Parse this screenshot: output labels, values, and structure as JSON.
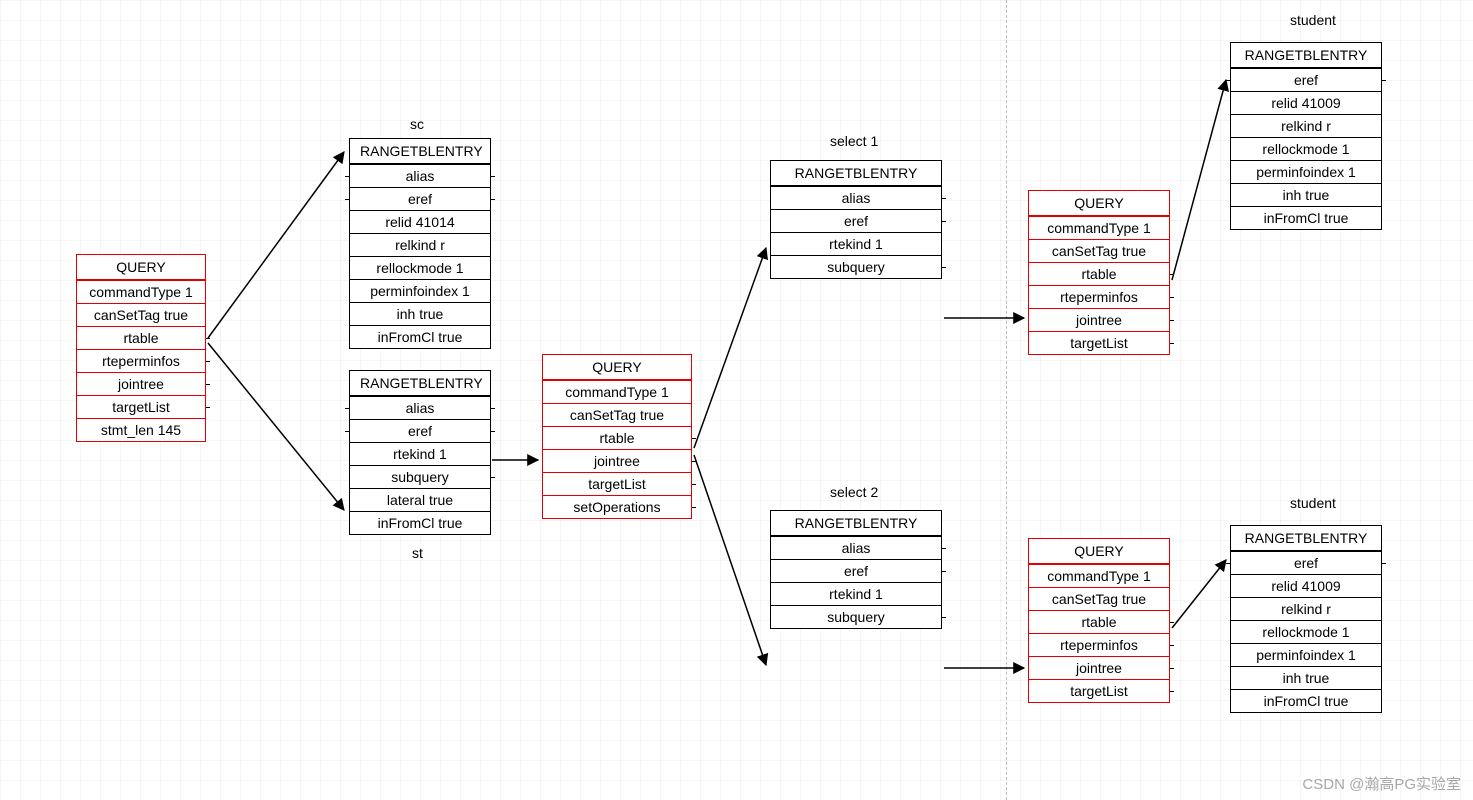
{
  "labels": {
    "sc": "sc",
    "st": "st",
    "select1": "select 1",
    "select2": "select 2",
    "student_top": "student",
    "student_bottom": "student"
  },
  "q1": {
    "title": "QUERY",
    "r0": "commandType 1",
    "r1": "canSetTag true",
    "r2": "rtable",
    "r3": "rteperminfos",
    "r4": "jointree",
    "r5": "targetList",
    "r6": "stmt_len 145"
  },
  "rte_sc": {
    "title": "RANGETBLENTRY",
    "r0": "alias",
    "r1": "eref",
    "r2": "relid 41014",
    "r3": "relkind r",
    "r4": "rellockmode 1",
    "r5": "perminfoindex 1",
    "r6": "inh true",
    "r7": "inFromCl true"
  },
  "rte_st": {
    "title": "RANGETBLENTRY",
    "r0": "alias",
    "r1": "eref",
    "r2": "rtekind 1",
    "r3": "subquery",
    "r4": "lateral true",
    "r5": "inFromCl true"
  },
  "q2": {
    "title": "QUERY",
    "r0": "commandType 1",
    "r1": "canSetTag true",
    "r2": "rtable",
    "r3": "jointree",
    "r4": "targetList",
    "r5": "setOperations"
  },
  "rte_sel1": {
    "title": "RANGETBLENTRY",
    "r0": "alias",
    "r1": "eref",
    "r2": "rtekind 1",
    "r3": "subquery"
  },
  "rte_sel2": {
    "title": "RANGETBLENTRY",
    "r0": "alias",
    "r1": "eref",
    "r2": "rtekind 1",
    "r3": "subquery"
  },
  "q3": {
    "title": "QUERY",
    "r0": "commandType 1",
    "r1": "canSetTag true",
    "r2": "rtable",
    "r3": "rteperminfos",
    "r4": "jointree",
    "r5": "targetList"
  },
  "q4": {
    "title": "QUERY",
    "r0": "commandType 1",
    "r1": "canSetTag true",
    "r2": "rtable",
    "r3": "rteperminfos",
    "r4": "jointree",
    "r5": "targetList"
  },
  "rte_stud1": {
    "title": "RANGETBLENTRY",
    "r0": "eref",
    "r1": "relid 41009",
    "r2": "relkind r",
    "r3": "rellockmode 1",
    "r4": "perminfoindex 1",
    "r5": "inh true",
    "r6": "inFromCl true"
  },
  "rte_stud2": {
    "title": "RANGETBLENTRY",
    "r0": "eref",
    "r1": "relid 41009",
    "r2": "relkind r",
    "r3": "rellockmode 1",
    "r4": "perminfoindex 1",
    "r5": "inh true",
    "r6": "inFromCl true"
  },
  "watermark": "CSDN @瀚高PG实验室"
}
